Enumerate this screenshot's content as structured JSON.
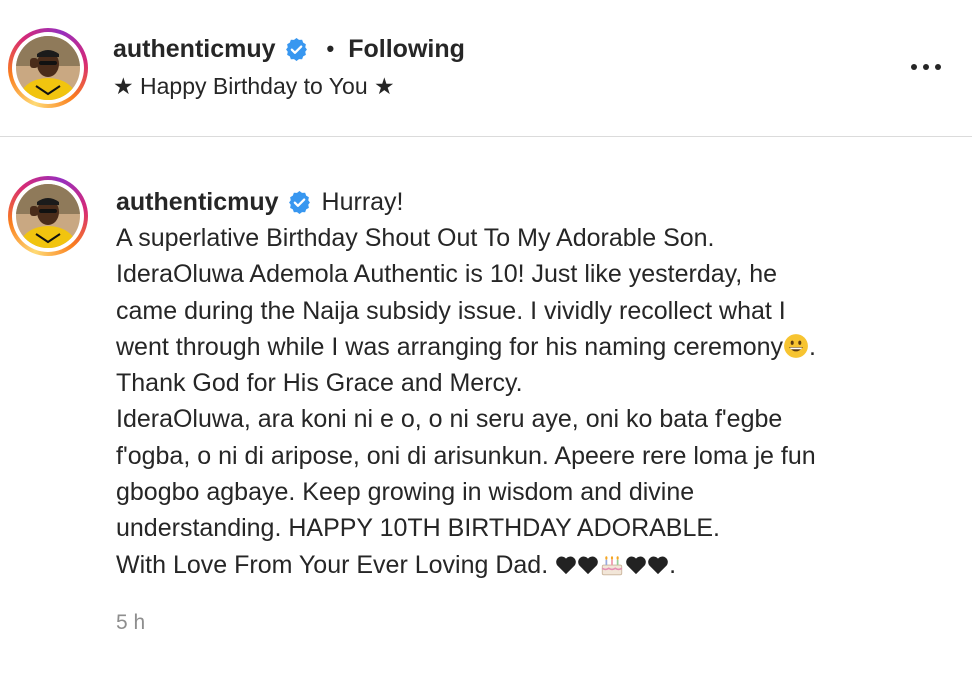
{
  "post": {
    "username": "authenticmuy",
    "separator": "•",
    "follow_status": "Following",
    "subtitle": "★ Happy Birthday to You ★",
    "more_icon": "more-horizontal-icon"
  },
  "comment": {
    "username": "authenticmuy",
    "first_text": "Hurray!",
    "lines": [
      "A superlative Birthday Shout Out To My Adorable Son.",
      "IderaOluwa Ademola Authentic is 10! Just like yesterday, he",
      "came during the Naija subsidy issue. I vividly recollect what I",
      "went through while I was arranging for his naming ceremony",
      "Thank God for His Grace and Mercy.",
      "IderaOluwa, ara koni ni e o, o ni seru aye, oni ko bata f'egbe",
      "f'ogba, o ni di aripose, oni di arisunkun. Apeere rere loma je fun",
      "gbogbo agbaye. Keep growing in wisdom and divine",
      "understanding. HAPPY 10TH BIRTHDAY ADORABLE.",
      "With Love From Your Ever Loving Dad."
    ],
    "line4_suffix": ".",
    "last_suffix": ".",
    "timestamp": "5 h"
  },
  "colors": {
    "verified": "#3897f0",
    "text": "#262626",
    "muted": "#8e8e8e",
    "divider": "#dbdbdb"
  }
}
